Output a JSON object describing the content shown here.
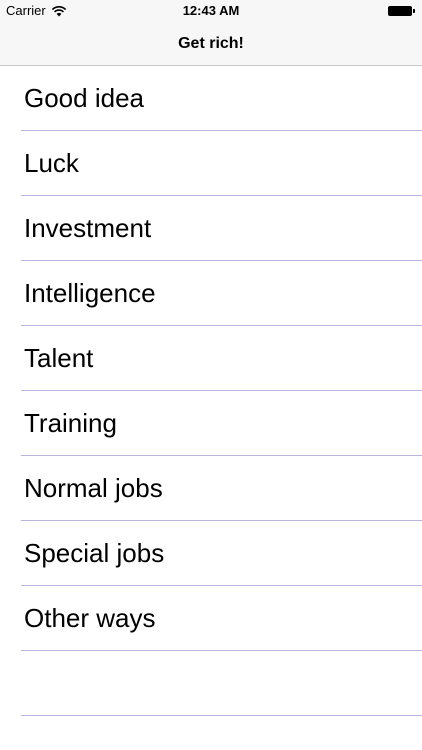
{
  "status_bar": {
    "carrier": "Carrier",
    "time": "12:43 AM",
    "wifi_icon": "wifi-icon",
    "battery_icon": "battery-icon"
  },
  "nav": {
    "title": "Get rich!"
  },
  "list": {
    "items": [
      {
        "label": "Good idea"
      },
      {
        "label": "Luck"
      },
      {
        "label": "Investment"
      },
      {
        "label": "Intelligence"
      },
      {
        "label": "Talent"
      },
      {
        "label": "Training"
      },
      {
        "label": "Normal jobs"
      },
      {
        "label": "Special jobs"
      },
      {
        "label": "Other ways"
      }
    ]
  },
  "colors": {
    "nav_background": "#f7f7f7",
    "separator": "#b9b6dc",
    "text": "#000000"
  }
}
